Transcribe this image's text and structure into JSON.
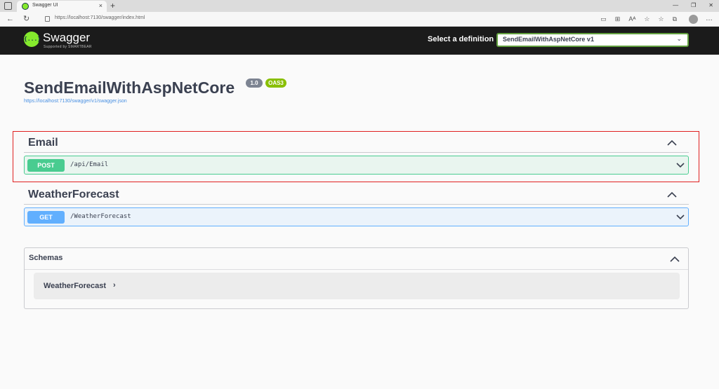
{
  "browser": {
    "tab_title": "Swagger UI",
    "tab_close": "×",
    "new_tab": "+",
    "url": "https://localhost:7130/swagger/index.html",
    "back": "←",
    "reload": "↻",
    "window_controls": [
      "—",
      "❐",
      "✕"
    ],
    "tools": [
      "▭",
      "⊞",
      "Aᴬ",
      "☆",
      "☆",
      "⧉"
    ],
    "menu": "…"
  },
  "swagger": {
    "logo_glyph": "{...}",
    "brand_name": "Swagger",
    "brand_sub": "Supported by SMARTBEAR",
    "definition_label": "Select a definition",
    "definition_value": "SendEmailWithAspNetCore v1"
  },
  "info": {
    "title": "SendEmailWithAspNetCore",
    "version": "1.0",
    "oas": "OAS3",
    "spec_url": "https://localhost:7130/swagger/v1/swagger.json"
  },
  "tags": [
    {
      "name": "Email",
      "operation": {
        "method": "POST",
        "path": "/api/Email"
      }
    },
    {
      "name": "WeatherForecast",
      "operation": {
        "method": "GET",
        "path": "/WeatherForecast"
      }
    }
  ],
  "schemas": {
    "title": "Schemas",
    "models": [
      {
        "name": "WeatherForecast",
        "expander": "›"
      }
    ]
  },
  "colors": {
    "topbar": "#1b1b1b",
    "post": "#49cc90",
    "get": "#61affe",
    "highlight": "#e02020",
    "swagger_green": "#85ea2d"
  }
}
